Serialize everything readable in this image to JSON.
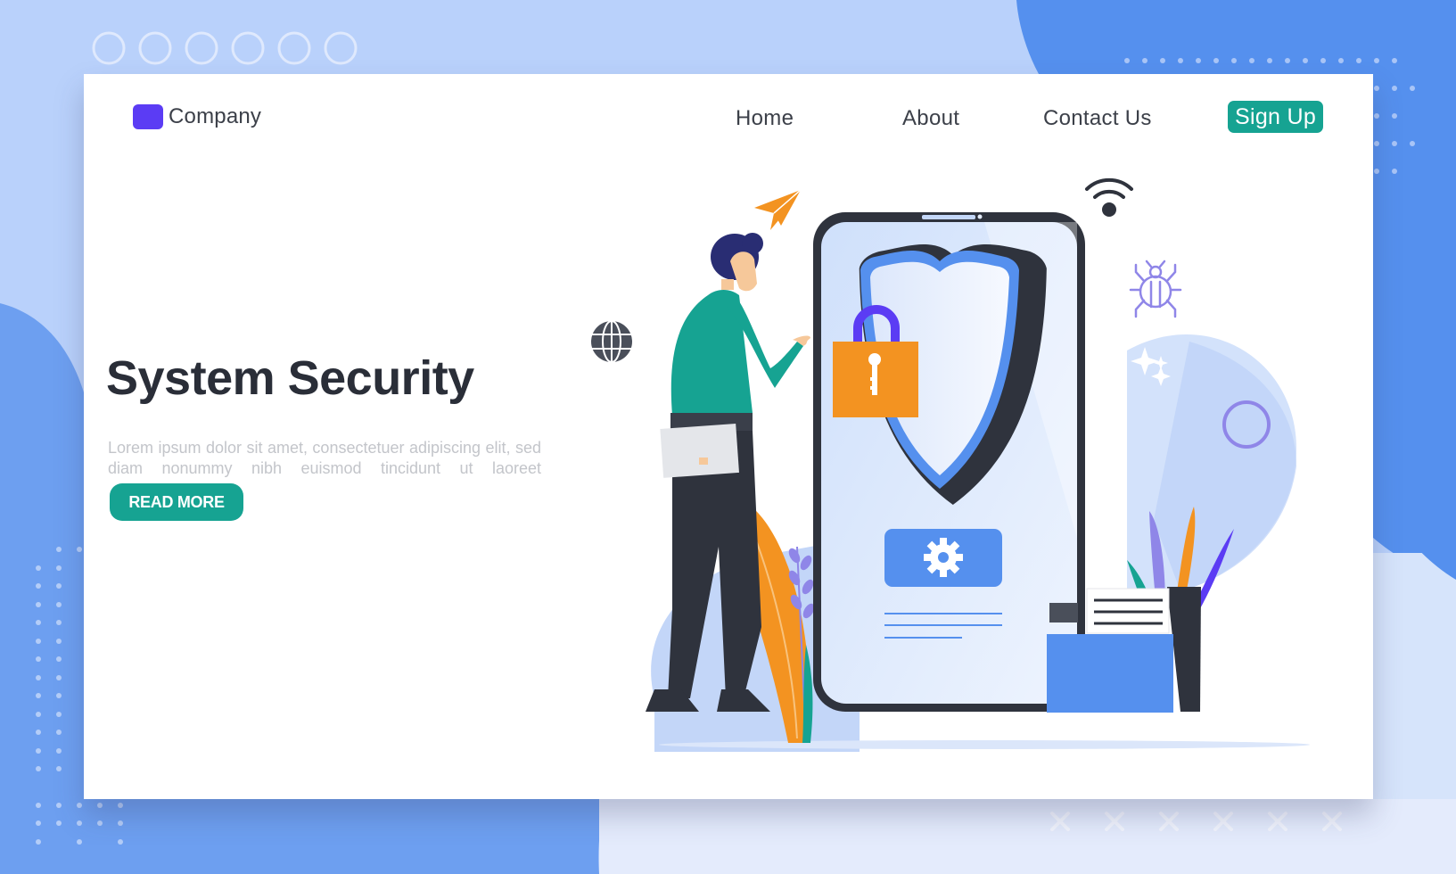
{
  "brand": {
    "name": "Company",
    "mark_color": "#5b3cf4"
  },
  "nav": {
    "items": [
      {
        "label": "Home"
      },
      {
        "label": "About"
      },
      {
        "label": "Contact Us"
      }
    ],
    "signup_label": "Sign Up"
  },
  "hero": {
    "title": "System Security",
    "body": "Lorem ipsum dolor sit amet, consectetuer adipiscing elit, sed diam nonummy nibh euismod tincidunt ut laoreet",
    "cta_label": "READ MORE"
  },
  "colors": {
    "accent": "#16a392",
    "primary_blue": "#5590ee",
    "light_blue": "#b9d1fb",
    "orange": "#f39321",
    "dark": "#2f333d",
    "purple": "#5b3cf4",
    "lavender": "#8f86e8"
  },
  "illustration": {
    "icons": [
      "paper-plane-icon",
      "globe-icon",
      "wifi-icon",
      "bug-icon",
      "sparkle-icon",
      "ring-icon",
      "padlock-icon",
      "shield-icon",
      "gear-icon",
      "smartphone",
      "folder-icon",
      "document-icon",
      "person"
    ]
  }
}
